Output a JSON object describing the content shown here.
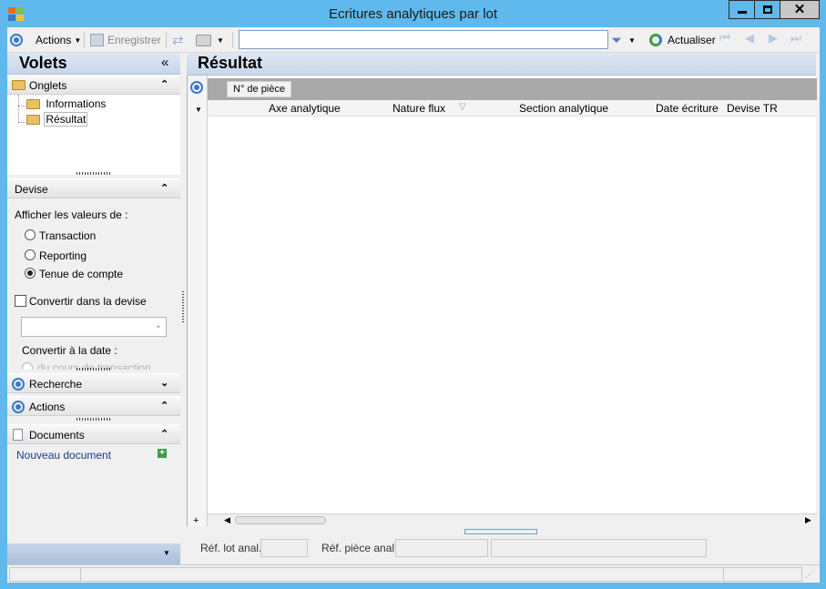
{
  "window": {
    "title": "Ecritures analytiques par lot",
    "controls": [
      "minimize-icon",
      "maximize-icon",
      "close-icon"
    ]
  },
  "toolbar": {
    "actions_label": "Actions",
    "save_label": "Enregistrer",
    "refresh_label": "Actualiser",
    "search_value": ""
  },
  "left": {
    "title": "Volets",
    "onglets": {
      "label": "Onglets",
      "items": [
        "Informations",
        "Résultat"
      ],
      "selected": "Résultat"
    },
    "devise": {
      "label": "Devise",
      "prompt": "Afficher les valeurs de :",
      "options": [
        "Transaction",
        "Reporting",
        "Tenue de compte"
      ],
      "selected": "Tenue de compte",
      "convert_label": "Convertir dans la devise",
      "convert_checked": false,
      "currency_value": "",
      "date_label": "Convertir à la date :",
      "date_option_partial": "du cours de transaction"
    },
    "recherche_label": "Recherche",
    "actions_label": "Actions",
    "documents": {
      "label": "Documents",
      "new_doc": "Nouveau document"
    }
  },
  "result": {
    "title": "Résultat",
    "group_by": "N° de pièce",
    "columns": [
      "Axe analytique",
      "Nature flux",
      "Section analytique",
      "Date écriture",
      "Devise TR"
    ],
    "rows": []
  },
  "fields": {
    "ref_lot_label": "Réf. lot  anal.",
    "ref_lot_value": "",
    "ref_piece_label": "Réf. pièce anal.",
    "ref_piece_value": "",
    "ref_piece_extra": ""
  },
  "colors": {
    "titlebar": "#5fb9ec",
    "panel_header": "#c8d6ea",
    "accent": "#3b77c9",
    "link": "#1a3a8f"
  }
}
